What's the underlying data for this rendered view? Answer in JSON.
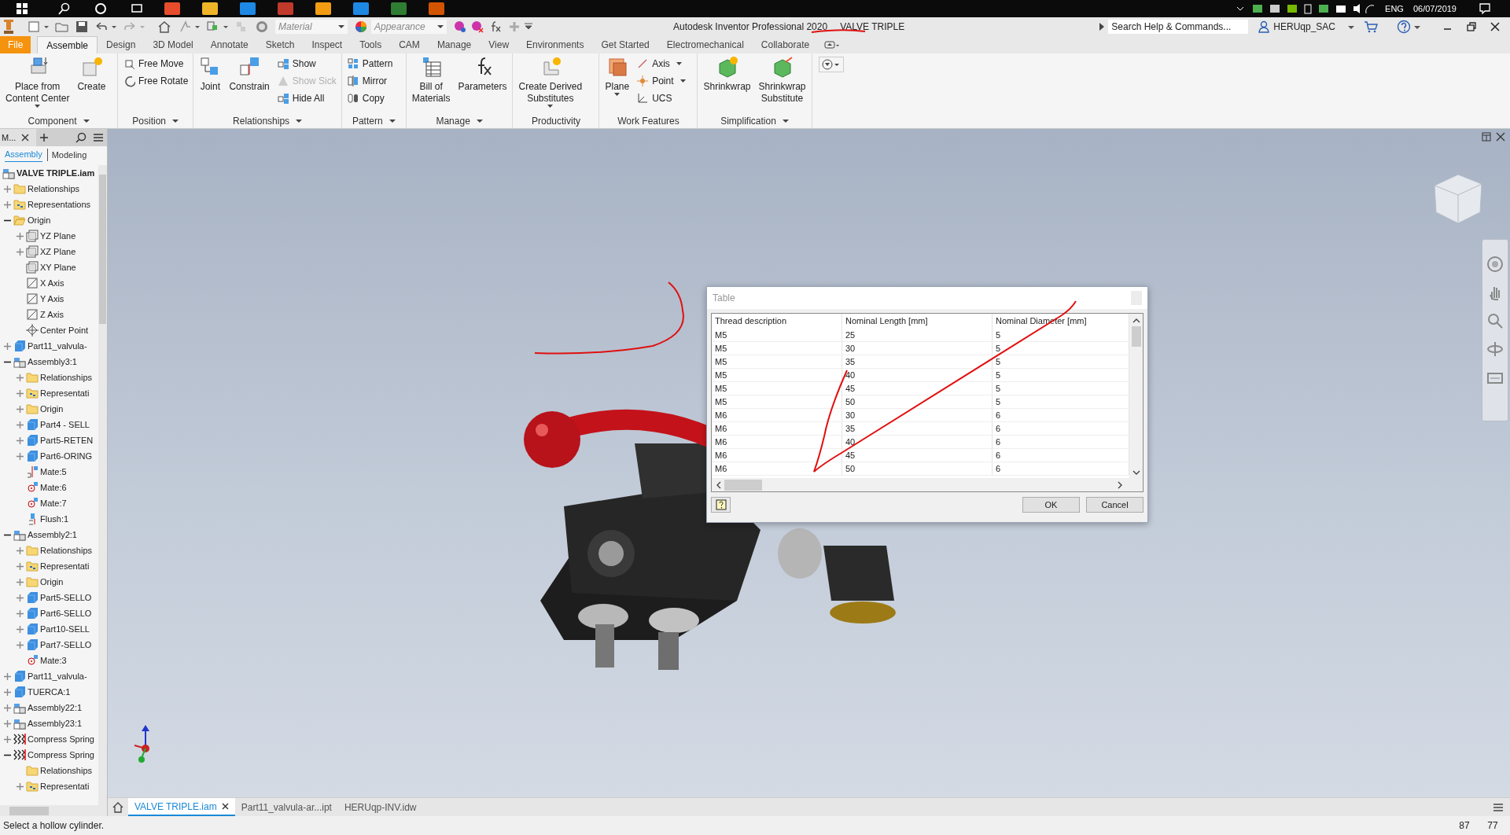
{
  "taskbar": {
    "language": "ENG",
    "date": "06/07/2019"
  },
  "quick_access": {
    "material": {
      "placeholder": "Material"
    },
    "appearance": {
      "placeholder": "Appearance"
    }
  },
  "window": {
    "title": "Autodesk Inventor Professional 2020",
    "document": "VALVE TRIPLE"
  },
  "search": {
    "placeholder": "Search Help & Commands..."
  },
  "user": "HERUqp_SAC",
  "menu_tabs": [
    {
      "label": "File",
      "kind": "file",
      "selected": false
    },
    {
      "label": "Assemble",
      "kind": "tab",
      "selected": true
    },
    {
      "label": "Design",
      "kind": "tab",
      "selected": false
    },
    {
      "label": "3D Model",
      "kind": "tab",
      "selected": false
    },
    {
      "label": "Annotate",
      "kind": "tab",
      "selected": false
    },
    {
      "label": "Sketch",
      "kind": "tab",
      "selected": false
    },
    {
      "label": "Inspect",
      "kind": "tab",
      "selected": false
    },
    {
      "label": "Tools",
      "kind": "tab",
      "selected": false
    },
    {
      "label": "CAM",
      "kind": "tab",
      "selected": false
    },
    {
      "label": "Manage",
      "kind": "tab",
      "selected": false
    },
    {
      "label": "View",
      "kind": "tab",
      "selected": false
    },
    {
      "label": "Environments",
      "kind": "tab",
      "selected": false
    },
    {
      "label": "Get Started",
      "kind": "tab",
      "selected": false
    },
    {
      "label": "Electromechanical",
      "kind": "tab",
      "selected": false
    },
    {
      "label": "Collaborate",
      "kind": "tab",
      "selected": false
    }
  ],
  "ribbon": [
    {
      "title": "Component",
      "has_menu": true,
      "tools": [
        {
          "label": "Place from\nContent Center",
          "kind": "large",
          "has_menu": true,
          "disabled": false
        },
        {
          "label": "Create",
          "kind": "large",
          "has_menu": false,
          "disabled": false
        }
      ]
    },
    {
      "title": "Position",
      "has_menu": true,
      "tools": [
        {
          "label": "Free Move",
          "kind": "small",
          "has_menu": false,
          "disabled": false
        },
        {
          "label": "Free Rotate",
          "kind": "small",
          "has_menu": false,
          "disabled": false
        }
      ]
    },
    {
      "title": "Relationships",
      "has_menu": true,
      "tools": [
        {
          "label": "Joint",
          "kind": "large",
          "has_menu": false,
          "disabled": false
        },
        {
          "label": "Constrain",
          "kind": "large",
          "has_menu": false,
          "disabled": false
        },
        {
          "label": "Show",
          "kind": "small",
          "has_menu": false,
          "disabled": false
        },
        {
          "label": "Show Sick",
          "kind": "small",
          "has_menu": false,
          "disabled": true
        },
        {
          "label": "Hide All",
          "kind": "small",
          "has_menu": false,
          "disabled": false
        }
      ]
    },
    {
      "title": "Pattern",
      "has_menu": true,
      "tools": [
        {
          "label": "Pattern",
          "kind": "small",
          "has_menu": false,
          "disabled": false
        },
        {
          "label": "Mirror",
          "kind": "small",
          "has_menu": false,
          "disabled": false
        },
        {
          "label": "Copy",
          "kind": "small",
          "has_menu": false,
          "disabled": false
        }
      ]
    },
    {
      "title": "Manage",
      "has_menu": true,
      "tools": [
        {
          "label": "Bill of\nMaterials",
          "kind": "large",
          "has_menu": false,
          "disabled": false
        },
        {
          "label": "Parameters",
          "kind": "large",
          "has_menu": false,
          "disabled": false
        }
      ]
    },
    {
      "title": "Productivity",
      "has_menu": false,
      "tools": [
        {
          "label": "Create Derived\nSubstitutes",
          "kind": "large",
          "has_menu": true,
          "disabled": false
        }
      ]
    },
    {
      "title": "Work Features",
      "has_menu": false,
      "tools": [
        {
          "label": "Plane",
          "kind": "large",
          "has_menu": true,
          "disabled": false
        },
        {
          "label": "Axis",
          "kind": "small",
          "has_menu": true,
          "disabled": false
        },
        {
          "label": "Point",
          "kind": "small",
          "has_menu": true,
          "disabled": false
        },
        {
          "label": "UCS",
          "kind": "small",
          "has_menu": false,
          "disabled": false
        }
      ]
    },
    {
      "title": "Simplification",
      "has_menu": true,
      "tools": [
        {
          "label": "Shrinkwrap",
          "kind": "large",
          "has_menu": false,
          "disabled": false
        },
        {
          "label": "Shrinkwrap\nSubstitute",
          "kind": "large",
          "has_menu": false,
          "disabled": false
        }
      ]
    }
  ],
  "browser": {
    "title": "M...",
    "tabs": [
      {
        "label": "Assembly",
        "selected": true
      },
      {
        "label": "Modeling",
        "selected": false
      }
    ],
    "tree": [
      {
        "label": "VALVE TRIPLE.iam",
        "kind": "root",
        "children": [
          {
            "label": "Relationships",
            "kind": "folder",
            "expanded": false
          },
          {
            "label": "Representations",
            "kind": "rep",
            "expanded": false
          },
          {
            "label": "Origin",
            "kind": "open-folder",
            "expanded": true,
            "children": [
              {
                "label": "YZ Plane",
                "kind": "plane",
                "expanded": false
              },
              {
                "label": "XZ Plane",
                "kind": "plane",
                "expanded": false
              },
              {
                "label": "XY Plane",
                "kind": "plane"
              },
              {
                "label": "X Axis",
                "kind": "axis"
              },
              {
                "label": "Y Axis",
                "kind": "axis"
              },
              {
                "label": "Z Axis",
                "kind": "axis"
              },
              {
                "label": "Center Point",
                "kind": "point"
              }
            ]
          },
          {
            "label": "Part11_valvula-",
            "kind": "part",
            "expanded": false
          },
          {
            "label": "Assembly3:1",
            "kind": "asm",
            "expanded": true,
            "children": [
              {
                "label": "Relationships",
                "kind": "folder",
                "expanded": false
              },
              {
                "label": "Representati",
                "kind": "rep",
                "expanded": false
              },
              {
                "label": "Origin",
                "kind": "folder",
                "expanded": false
              },
              {
                "label": "Part4 - SELL",
                "kind": "part",
                "expanded": false
              },
              {
                "label": "Part5-RETEN",
                "kind": "part",
                "expanded": false
              },
              {
                "label": "Part6-ORING",
                "kind": "part",
                "expanded": false
              },
              {
                "label": "Mate:5",
                "kind": "mate"
              },
              {
                "label": "Mate:6",
                "kind": "mate-round"
              },
              {
                "label": "Mate:7",
                "kind": "mate-round"
              },
              {
                "label": "Flush:1",
                "kind": "flush"
              }
            ]
          },
          {
            "label": "Assembly2:1",
            "kind": "asm",
            "expanded": true,
            "children": [
              {
                "label": "Relationships",
                "kind": "folder",
                "expanded": false
              },
              {
                "label": "Representati",
                "kind": "rep",
                "expanded": false
              },
              {
                "label": "Origin",
                "kind": "folder",
                "expanded": false
              },
              {
                "label": "Part5-SELLO",
                "kind": "part",
                "expanded": false
              },
              {
                "label": "Part6-SELLO",
                "kind": "part",
                "expanded": false
              },
              {
                "label": "Part10-SELL",
                "kind": "part",
                "expanded": false
              },
              {
                "label": "Part7-SELLO",
                "kind": "part",
                "expanded": false
              },
              {
                "label": "Mate:3",
                "kind": "mate-round"
              }
            ]
          },
          {
            "label": "Part11_valvula-",
            "kind": "part",
            "expanded": false
          },
          {
            "label": "TUERCA:1",
            "kind": "part",
            "expanded": false
          },
          {
            "label": "Assembly22:1",
            "kind": "asm",
            "expanded": false
          },
          {
            "label": "Assembly23:1",
            "kind": "asm",
            "expanded": false
          },
          {
            "label": "Compress Spring",
            "kind": "spring",
            "expanded": false
          },
          {
            "label": "Compress Spring",
            "kind": "spring",
            "expanded": true,
            "children": [
              {
                "label": "Relationships",
                "kind": "folder"
              },
              {
                "label": "Representati",
                "kind": "rep",
                "expanded": false
              }
            ]
          }
        ]
      }
    ]
  },
  "dialog": {
    "title": "Table",
    "columns": [
      "Thread description",
      "Nominal Length [mm]",
      "Nominal Diameter [mm]"
    ],
    "rows": [
      [
        "M5",
        "25",
        "5"
      ],
      [
        "M5",
        "30",
        "5"
      ],
      [
        "M5",
        "35",
        "5"
      ],
      [
        "M5",
        "40",
        "5"
      ],
      [
        "M5",
        "45",
        "5"
      ],
      [
        "M5",
        "50",
        "5"
      ],
      [
        "M6",
        "30",
        "6"
      ],
      [
        "M6",
        "35",
        "6"
      ],
      [
        "M6",
        "40",
        "6"
      ],
      [
        "M6",
        "45",
        "6"
      ],
      [
        "M6",
        "50",
        "6"
      ]
    ],
    "buttons": [
      "OK",
      "Cancel"
    ]
  },
  "doc_tabs": [
    {
      "label": "VALVE TRIPLE.iam",
      "selected": true
    },
    {
      "label": "Part11_valvula-ar...ipt",
      "selected": false
    },
    {
      "label": "HERUqp-INV.idw",
      "selected": false
    }
  ],
  "status_bar": {
    "prompt": "Select a hollow cylinder.",
    "values": [
      "87",
      "77"
    ]
  }
}
